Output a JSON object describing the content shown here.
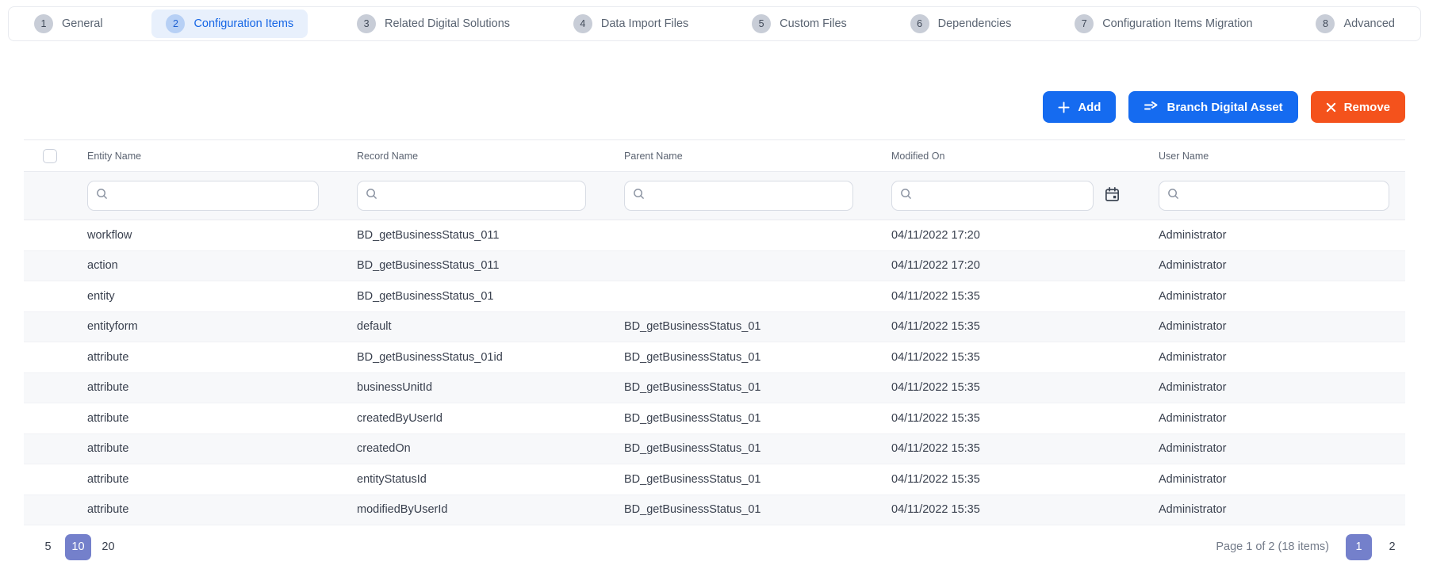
{
  "tabs": [
    {
      "number": "1",
      "label": "General",
      "active": false
    },
    {
      "number": "2",
      "label": "Configuration Items",
      "active": true
    },
    {
      "number": "3",
      "label": "Related Digital Solutions",
      "active": false
    },
    {
      "number": "4",
      "label": "Data Import Files",
      "active": false
    },
    {
      "number": "5",
      "label": "Custom Files",
      "active": false
    },
    {
      "number": "6",
      "label": "Dependencies",
      "active": false
    },
    {
      "number": "7",
      "label": "Configuration Items Migration",
      "active": false
    },
    {
      "number": "8",
      "label": "Advanced",
      "active": false
    }
  ],
  "toolbar": {
    "add_label": "Add",
    "branch_label": "Branch Digital Asset",
    "remove_label": "Remove"
  },
  "table": {
    "columns": [
      {
        "label": "Entity Name",
        "has_calendar": false
      },
      {
        "label": "Record Name",
        "has_calendar": false
      },
      {
        "label": "Parent Name",
        "has_calendar": false
      },
      {
        "label": "Modified On",
        "has_calendar": true
      },
      {
        "label": "User Name",
        "has_calendar": false
      }
    ],
    "filter_values": {
      "entity_name": "",
      "record_name": "",
      "parent_name": "",
      "modified_on": "",
      "user_name": ""
    },
    "rows": [
      {
        "entity_name": "workflow",
        "record_name": "BD_getBusinessStatus_011",
        "parent_name": "",
        "modified_on": "04/11/2022 17:20",
        "user_name": "Administrator"
      },
      {
        "entity_name": "action",
        "record_name": "BD_getBusinessStatus_011",
        "parent_name": "",
        "modified_on": "04/11/2022 17:20",
        "user_name": "Administrator"
      },
      {
        "entity_name": "entity",
        "record_name": "BD_getBusinessStatus_01",
        "parent_name": "",
        "modified_on": "04/11/2022 15:35",
        "user_name": "Administrator"
      },
      {
        "entity_name": "entityform",
        "record_name": "default",
        "parent_name": "BD_getBusinessStatus_01",
        "modified_on": "04/11/2022 15:35",
        "user_name": "Administrator"
      },
      {
        "entity_name": "attribute",
        "record_name": "BD_getBusinessStatus_01id",
        "parent_name": "BD_getBusinessStatus_01",
        "modified_on": "04/11/2022 15:35",
        "user_name": "Administrator"
      },
      {
        "entity_name": "attribute",
        "record_name": "businessUnitId",
        "parent_name": "BD_getBusinessStatus_01",
        "modified_on": "04/11/2022 15:35",
        "user_name": "Administrator"
      },
      {
        "entity_name": "attribute",
        "record_name": "createdByUserId",
        "parent_name": "BD_getBusinessStatus_01",
        "modified_on": "04/11/2022 15:35",
        "user_name": "Administrator"
      },
      {
        "entity_name": "attribute",
        "record_name": "createdOn",
        "parent_name": "BD_getBusinessStatus_01",
        "modified_on": "04/11/2022 15:35",
        "user_name": "Administrator"
      },
      {
        "entity_name": "attribute",
        "record_name": "entityStatusId",
        "parent_name": "BD_getBusinessStatus_01",
        "modified_on": "04/11/2022 15:35",
        "user_name": "Administrator"
      },
      {
        "entity_name": "attribute",
        "record_name": "modifiedByUserId",
        "parent_name": "BD_getBusinessStatus_01",
        "modified_on": "04/11/2022 15:35",
        "user_name": "Administrator"
      }
    ]
  },
  "pagination": {
    "sizes": [
      {
        "label": "5",
        "selected": false
      },
      {
        "label": "10",
        "selected": true
      },
      {
        "label": "20",
        "selected": false
      }
    ],
    "summary": "Page 1 of 2 (18 items)",
    "pages": [
      {
        "label": "1",
        "current": true
      },
      {
        "label": "2",
        "current": false
      }
    ]
  },
  "colors": {
    "accent_blue": "#156bf0",
    "accent_orange": "#f4521c",
    "active_tab_blue": "#1666e5",
    "selected_indigo": "#7480cb"
  }
}
